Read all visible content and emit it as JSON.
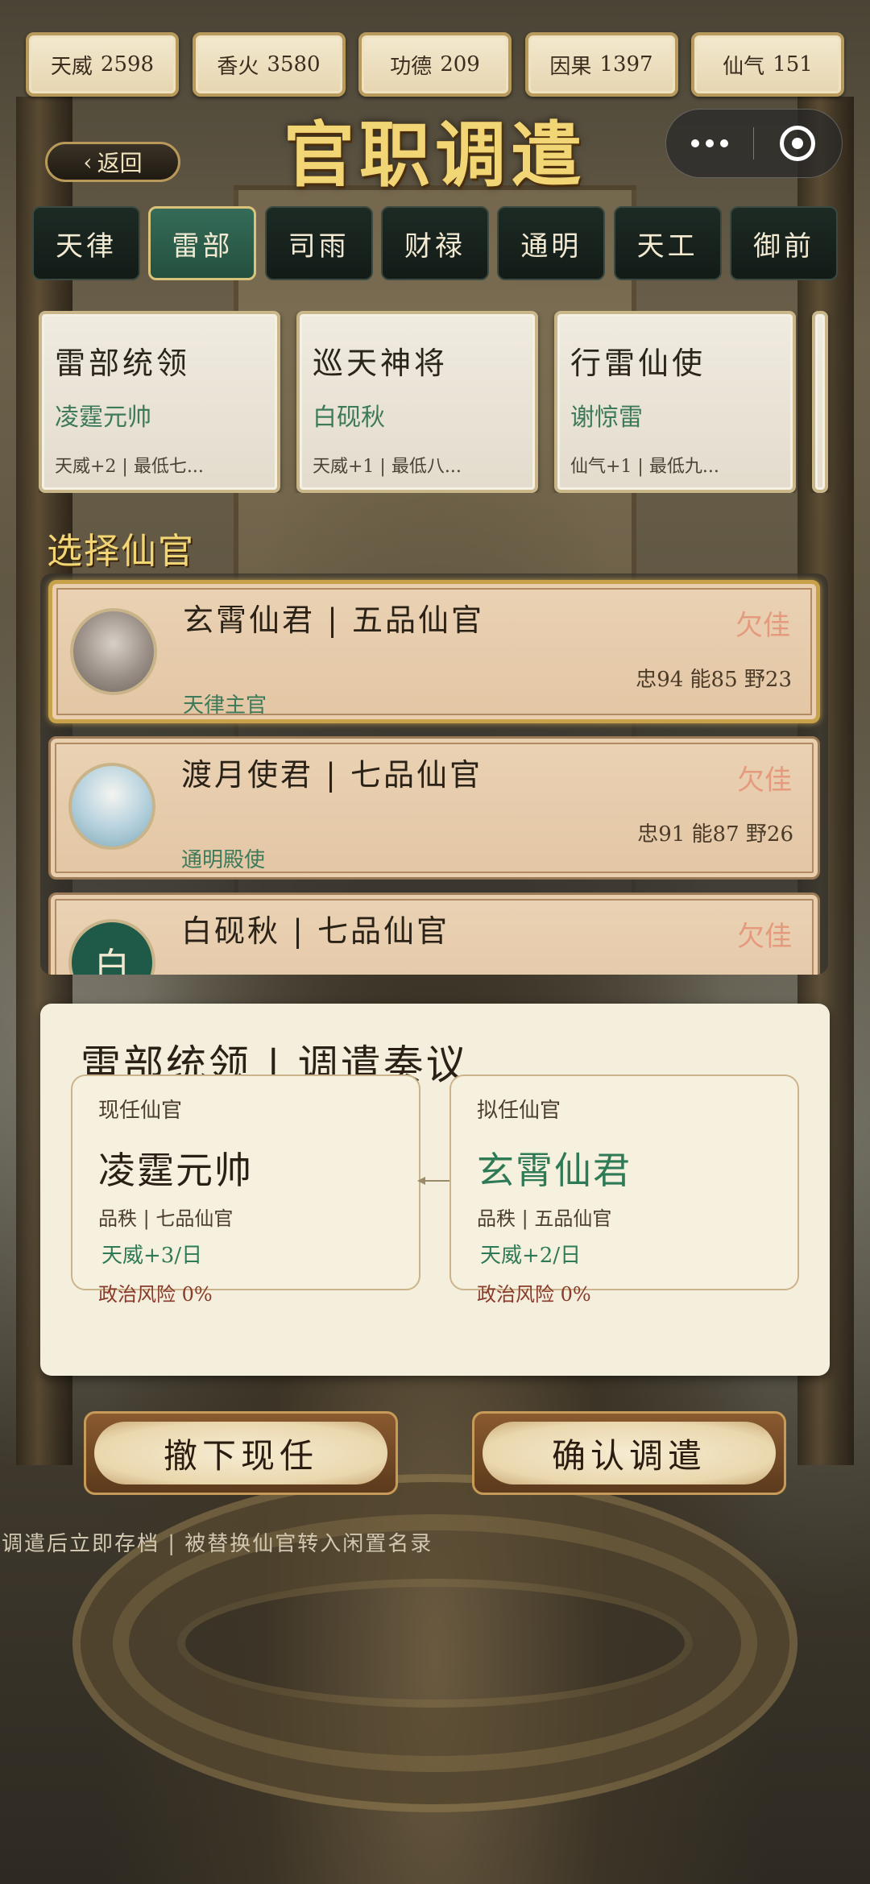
{
  "resources": [
    {
      "name": "天威",
      "value": "2598"
    },
    {
      "name": "香火",
      "value": "3580"
    },
    {
      "name": "功德",
      "value": "209"
    },
    {
      "name": "因果",
      "value": "1397"
    },
    {
      "name": "仙气",
      "value": "151"
    }
  ],
  "header": {
    "back_label": "返回",
    "back_chevron": "‹",
    "title": "官职调遣"
  },
  "tabs": [
    "天律",
    "雷部",
    "司雨",
    "财禄",
    "通明",
    "天工",
    "御前"
  ],
  "active_tab": "雷部",
  "positions": [
    {
      "title": "雷部统领",
      "holder": "凌霆元帅",
      "note": "天威+2 | 最低七..."
    },
    {
      "title": "巡天神将",
      "holder": "白砚秋",
      "note": "天威+1 | 最低八..."
    },
    {
      "title": "行雷仙使",
      "holder": "谢惊雷",
      "note": "仙气+1 | 最低九..."
    }
  ],
  "select_label": "选择仙官",
  "candidates": [
    {
      "name": "玄霄仙君 | 五品仙官",
      "status": "欠佳",
      "stats": "忠94 能85 野23",
      "role": "天律主官",
      "avatar": "portrait"
    },
    {
      "name": "渡月使君 | 七品仙官",
      "status": "欠佳",
      "stats": "忠91 能87 野26",
      "role": "通明殿使",
      "avatar": "portrait"
    },
    {
      "name": "白砚秋 | 七品仙官",
      "status": "欠佳",
      "stats": "",
      "role": "",
      "avatar": "白"
    }
  ],
  "proposal": {
    "title": "雷部统领 | 调遣奏议",
    "current": {
      "label": "现任仙官",
      "name": "凌霆元帅",
      "rank": "品秩 | 七品仙官",
      "bonus": "天威+3/日",
      "risk": "政治风险 0%"
    },
    "proposed": {
      "label": "拟任仙官",
      "name": "玄霄仙君",
      "rank": "品秩 | 五品仙官",
      "bonus": "天威+2/日",
      "risk": "政治风险 0%"
    }
  },
  "actions": {
    "remove": "撤下现任",
    "confirm": "确认调遣"
  },
  "footnote": "调遣后立即存档 | 被替换仙官转入闲置名录",
  "colors": {
    "title_gold": "#f2d675",
    "active_tab": "#356b58",
    "accent_green": "#2f7a56",
    "status_red": "#e59a7e"
  }
}
